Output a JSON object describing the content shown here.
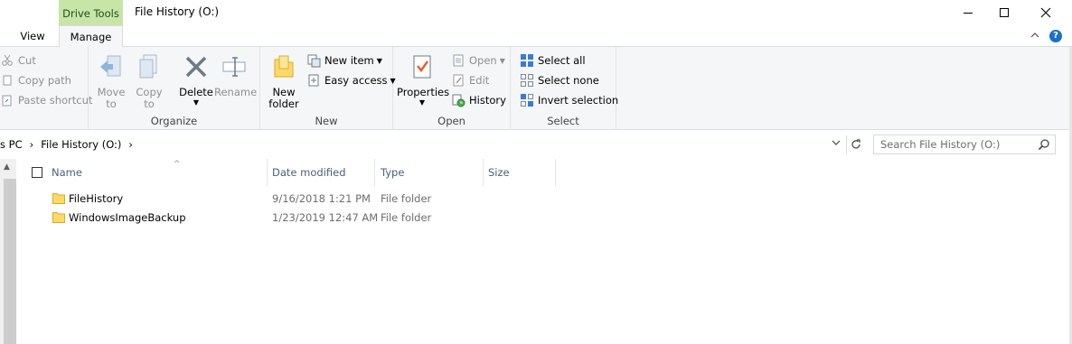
{
  "titlebar": {
    "context_tab_header": "Drive Tools",
    "title": "File History (O:)"
  },
  "tabs": {
    "view": "View",
    "manage": "Manage"
  },
  "ribbon": {
    "clipboard": {
      "cut": "Cut",
      "copy_path": "Copy path",
      "paste_shortcut": "Paste shortcut"
    },
    "organize": {
      "label": "Organize",
      "move_to": [
        "Move",
        "to"
      ],
      "copy_to": [
        "Copy",
        "to"
      ],
      "delete": "Delete",
      "rename": "Rename"
    },
    "new": {
      "label": "New",
      "new_folder": [
        "New",
        "folder"
      ],
      "new_item": "New item",
      "easy_access": "Easy access"
    },
    "open": {
      "label": "Open",
      "properties": "Properties",
      "open": "Open",
      "edit": "Edit",
      "history": "History"
    },
    "select": {
      "label": "Select",
      "select_all": "Select all",
      "select_none": "Select none",
      "invert_selection": "Invert selection"
    }
  },
  "address": {
    "crumb_pc": "s PC",
    "crumb_drive": "File History (O:)",
    "search_placeholder": "Search File History (O:)"
  },
  "columns": {
    "name": "Name",
    "date_modified": "Date modified",
    "type": "Type",
    "size": "Size"
  },
  "files": [
    {
      "name": "FileHistory",
      "date": "9/16/2018 1:21 PM",
      "type": "File folder"
    },
    {
      "name": "WindowsImageBackup",
      "date": "1/23/2019 12:47 AM",
      "type": "File folder"
    }
  ],
  "colors": {
    "context_tab": "#c6e5a7",
    "ribbon_bg": "#f5f6f7",
    "header_text": "#4c607a",
    "folder": "#ffd966"
  }
}
